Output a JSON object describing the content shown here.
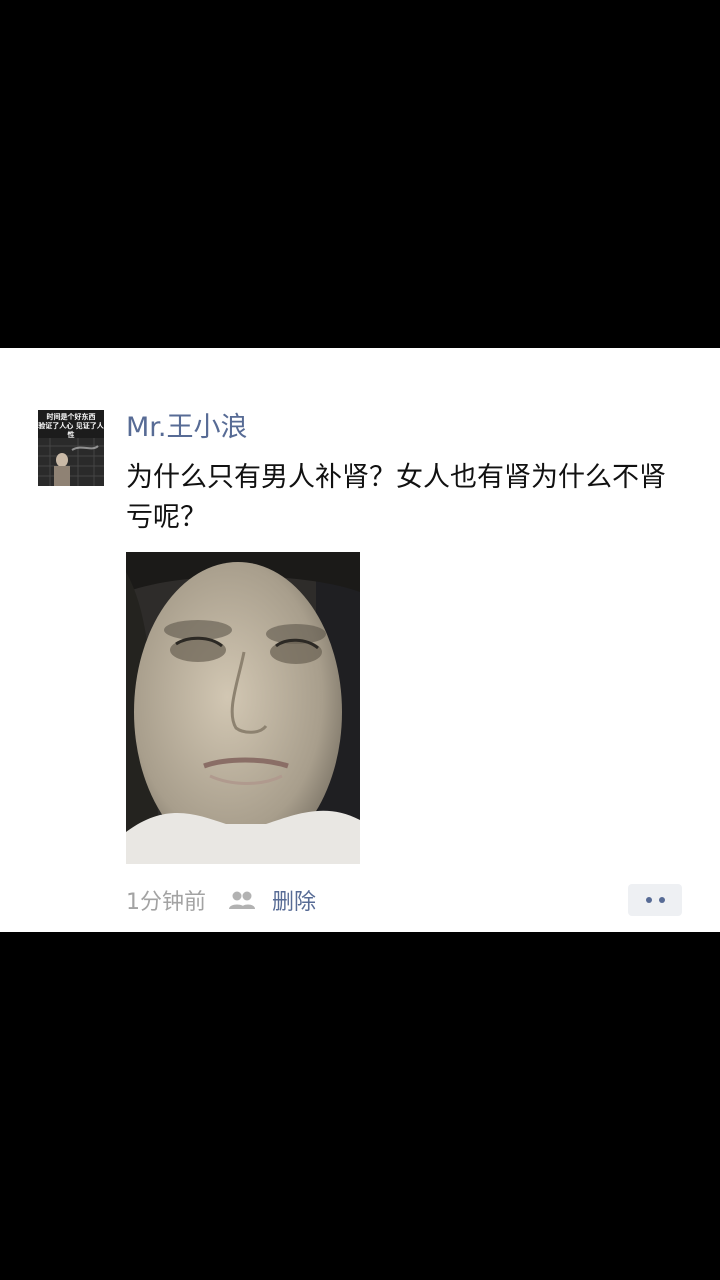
{
  "post": {
    "username": "Mr.王小浪",
    "text": "为什么只有男人补肾？女人也有肾为什么不肾亏呢？",
    "time": "1分钟前",
    "delete_label": "删除"
  },
  "avatar": {
    "caption_line1": "时间是个好东西",
    "caption_line2": "验证了人心 见证了人性"
  },
  "icons": {
    "visibility": "people-icon",
    "more": "more-icon"
  },
  "colors": {
    "link": "#576b95",
    "time": "#a3a3a3",
    "text": "#111111",
    "more_bg": "#eef0f3"
  }
}
